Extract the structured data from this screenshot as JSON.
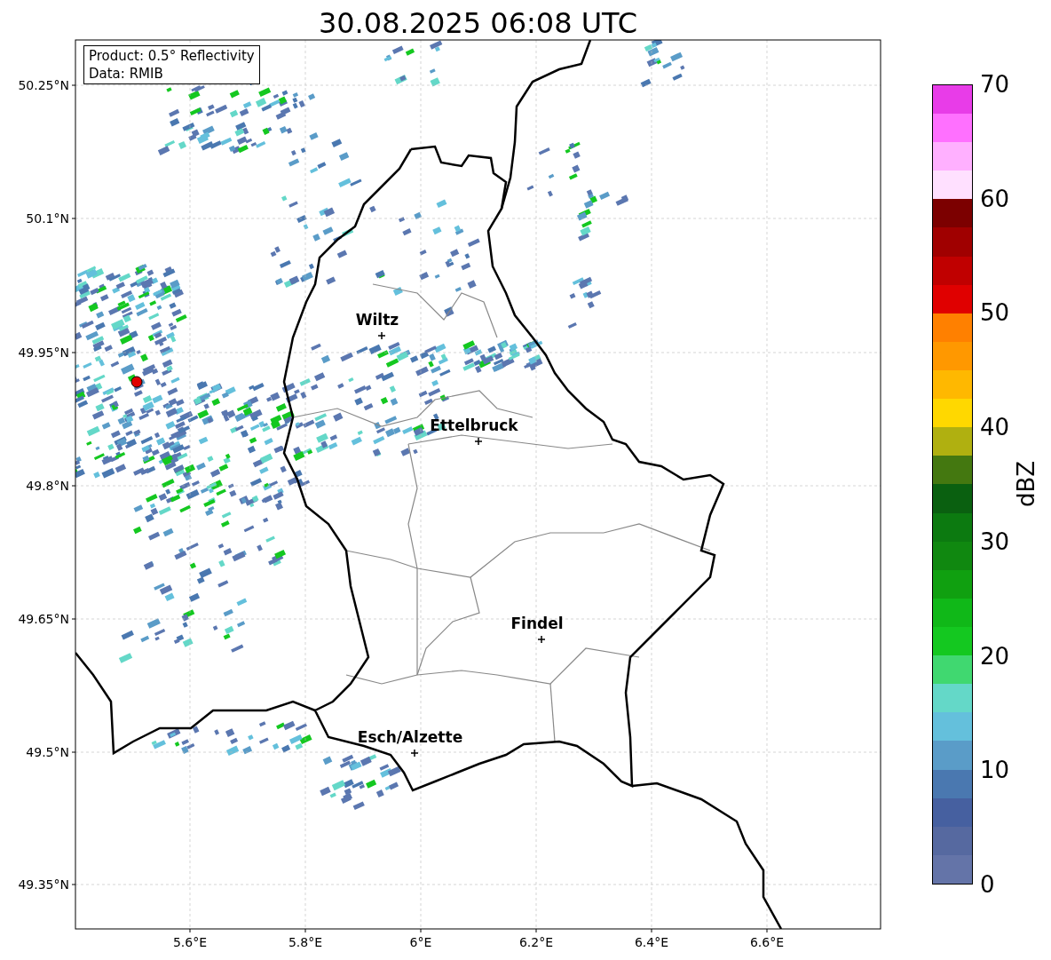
{
  "title": "30.08.2025 06:08 UTC",
  "info_box": [
    "Product: 0.5° Reflectivity",
    "Data: RMIB"
  ],
  "y_ticks": [
    "50.25°N",
    "50.1°N",
    "49.95°N",
    "49.8°N",
    "49.65°N",
    "49.5°N",
    "49.35°N"
  ],
  "x_ticks": [
    "5.6°E",
    "5.8°E",
    "6°E",
    "6.2°E",
    "6.4°E",
    "6.6°E"
  ],
  "cities": [
    {
      "name": "Wiltz"
    },
    {
      "name": "Ettelbruck"
    },
    {
      "name": "Findel"
    },
    {
      "name": "Esch/Alzette"
    }
  ],
  "colorbar": {
    "label": "dBZ",
    "ticks": [
      "70",
      "60",
      "50",
      "40",
      "30",
      "20",
      "10",
      "0"
    ],
    "segments": [
      {
        "color": "#6474a8"
      },
      {
        "color": "#5669a0"
      },
      {
        "color": "#4660a0"
      },
      {
        "color": "#4a78b0"
      },
      {
        "color": "#5a9cc8"
      },
      {
        "color": "#64c0dc"
      },
      {
        "color": "#64d8c8"
      },
      {
        "color": "#40d870"
      },
      {
        "color": "#14c820"
      },
      {
        "color": "#10b818"
      },
      {
        "color": "#10a010"
      },
      {
        "color": "#108810"
      },
      {
        "color": "#0c7a10"
      },
      {
        "color": "#0a6010"
      },
      {
        "color": "#447810"
      },
      {
        "color": "#b0b010"
      },
      {
        "color": "#ffd800"
      },
      {
        "color": "#ffb800"
      },
      {
        "color": "#ff9800"
      },
      {
        "color": "#ff8000"
      },
      {
        "color": "#e00000"
      },
      {
        "color": "#c00000"
      },
      {
        "color": "#a00000"
      },
      {
        "color": "#7c0000"
      },
      {
        "color": "#ffe0ff"
      },
      {
        "color": "#ffb0ff"
      },
      {
        "color": "#ff70ff"
      },
      {
        "color": "#e83ce8"
      }
    ]
  }
}
